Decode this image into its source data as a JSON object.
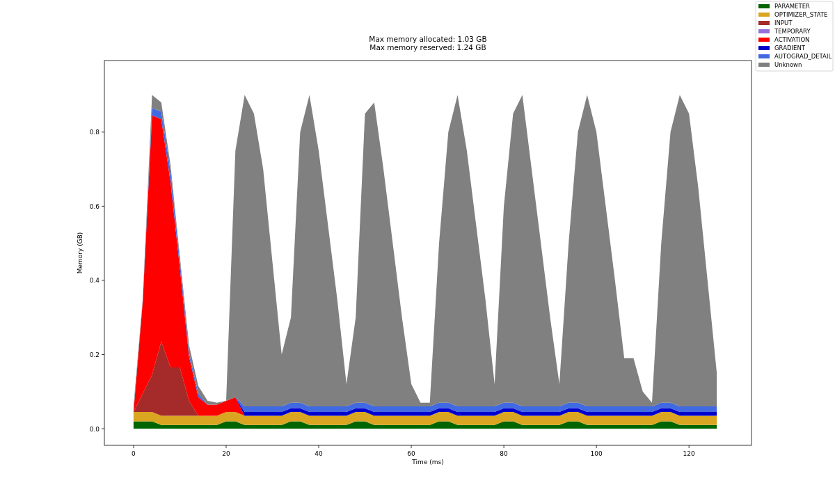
{
  "figure": {
    "chart_data": {
      "type": "area",
      "stacked": true,
      "legend": "upper right",
      "title": "Max memory allocated: 1.03 GB\nMax memory reserved: 1.24 GB",
      "xlabel": "Time (ms)",
      "ylabel": "Memory (GB)",
      "x": [
        0,
        2,
        4,
        6,
        8,
        10,
        12,
        14,
        16,
        18,
        20,
        22,
        24,
        26,
        28,
        30,
        32,
        34,
        36,
        38,
        40,
        42,
        44,
        46,
        48,
        50,
        52,
        54,
        56,
        58,
        60,
        62,
        64,
        66,
        68,
        70,
        72,
        74,
        76,
        78,
        80,
        82,
        84,
        86,
        88,
        90,
        92,
        94,
        96,
        98,
        100,
        102,
        104,
        106,
        108,
        110,
        112,
        114,
        116,
        118,
        120,
        122,
        124,
        126
      ],
      "xlim": [
        -6.3,
        133.5
      ],
      "ylim": [
        -0.045,
        0.993
      ],
      "xticks": [
        0,
        20,
        40,
        60,
        80,
        100,
        120
      ],
      "yticks": [
        {
          "value": 0,
          "label": "0.0"
        },
        {
          "value": 0.2,
          "label": "0.2"
        },
        {
          "value": 0.4,
          "label": "0.4"
        },
        {
          "value": 0.6,
          "label": "0.6"
        },
        {
          "value": 0.8,
          "label": "0.8"
        }
      ],
      "series": [
        {
          "name": "PARAMETER",
          "color": "#006400",
          "values": [
            0.02,
            0.02,
            0.02,
            0.01,
            0.01,
            0.01,
            0.01,
            0.01,
            0.01,
            0.01,
            0.02,
            0.02,
            0.01,
            0.01,
            0.01,
            0.01,
            0.01,
            0.02,
            0.02,
            0.01,
            0.01,
            0.01,
            0.01,
            0.01,
            0.02,
            0.02,
            0.01,
            0.01,
            0.01,
            0.01,
            0.01,
            0.01,
            0.01,
            0.02,
            0.02,
            0.01,
            0.01,
            0.01,
            0.01,
            0.01,
            0.02,
            0.02,
            0.01,
            0.01,
            0.01,
            0.01,
            0.01,
            0.02,
            0.02,
            0.01,
            0.01,
            0.01,
            0.01,
            0.01,
            0.01,
            0.01,
            0.01,
            0.02,
            0.02,
            0.01,
            0.01,
            0.01,
            0.01,
            0.01
          ]
        },
        {
          "name": "OPTIMIZER_STATE",
          "color": "#daa520",
          "values": [
            0.025,
            0.025,
            0.025,
            0.025,
            0.025,
            0.025,
            0.025,
            0.025,
            0.025,
            0.025,
            0.025,
            0.025,
            0.025,
            0.025,
            0.025,
            0.025,
            0.025,
            0.025,
            0.025,
            0.025,
            0.025,
            0.025,
            0.025,
            0.025,
            0.025,
            0.025,
            0.025,
            0.025,
            0.025,
            0.025,
            0.025,
            0.025,
            0.025,
            0.025,
            0.025,
            0.025,
            0.025,
            0.025,
            0.025,
            0.025,
            0.025,
            0.025,
            0.025,
            0.025,
            0.025,
            0.025,
            0.025,
            0.025,
            0.025,
            0.025,
            0.025,
            0.025,
            0.025,
            0.025,
            0.025,
            0.025,
            0.025,
            0.025,
            0.025,
            0.025,
            0.025,
            0.025,
            0.025,
            0.025
          ]
        },
        {
          "name": "INPUT",
          "color": "#a52a2a",
          "values": [
            0,
            0.05,
            0.1,
            0.2,
            0.13,
            0.13,
            0.04,
            0,
            null,
            null,
            null,
            null,
            null,
            null,
            null,
            null,
            null,
            null,
            null,
            null,
            null,
            null,
            null,
            null,
            null,
            null,
            null,
            null,
            null,
            null,
            null,
            null,
            null,
            null,
            null,
            null,
            null,
            null,
            null,
            null,
            null,
            null,
            null,
            null,
            null,
            null,
            null,
            null,
            null,
            null,
            null,
            null,
            null,
            null,
            null,
            null,
            null,
            null,
            null,
            null,
            null,
            null,
            null,
            null
          ]
        },
        {
          "name": "TEMPORARY",
          "color": "#9370db",
          "values": [
            null,
            null,
            null,
            null,
            null,
            null,
            null,
            null,
            null,
            null,
            null,
            null,
            null,
            null,
            null,
            null,
            null,
            null,
            null,
            null,
            null,
            null,
            null,
            null,
            null,
            null,
            null,
            null,
            null,
            null,
            null,
            null,
            null,
            null,
            null,
            null,
            null,
            null,
            null,
            null,
            null,
            null,
            null,
            null,
            null,
            null,
            null,
            null,
            null,
            null,
            null,
            null,
            null,
            null,
            null,
            null,
            null,
            null,
            null,
            null,
            null,
            null,
            null,
            null
          ]
        },
        {
          "name": "ACTIVATION",
          "color": "#ff0000",
          "values": [
            0,
            0.25,
            0.7,
            0.6,
            0.5,
            0.27,
            0.12,
            0.05,
            0.03,
            0.03,
            0.03,
            0.04,
            0,
            null,
            null,
            null,
            null,
            null,
            null,
            null,
            null,
            null,
            null,
            null,
            null,
            null,
            null,
            null,
            null,
            null,
            null,
            null,
            null,
            null,
            null,
            null,
            null,
            null,
            null,
            null,
            null,
            null,
            null,
            null,
            null,
            null,
            null,
            null,
            null,
            null,
            null,
            null,
            null,
            null,
            null,
            null,
            null,
            null,
            null,
            null,
            null,
            null,
            null,
            null
          ]
        },
        {
          "name": "GRADIENT",
          "color": "#0000cd",
          "values": [
            null,
            null,
            null,
            null,
            null,
            null,
            null,
            null,
            null,
            null,
            null,
            0,
            0.01,
            0.01,
            0.01,
            0.01,
            0.01,
            0.01,
            0.01,
            0.01,
            0.01,
            0.01,
            0.01,
            0.01,
            0.01,
            0.01,
            0.01,
            0.01,
            0.01,
            0.01,
            0.01,
            0.01,
            0.01,
            0.01,
            0.01,
            0.01,
            0.01,
            0.01,
            0.01,
            0.01,
            0.01,
            0.01,
            0.01,
            0.01,
            0.01,
            0.01,
            0.01,
            0.01,
            0.01,
            0.01,
            0.01,
            0.01,
            0.01,
            0.01,
            0.01,
            0.01,
            0.01,
            0.01,
            0.01,
            0.01,
            0.01,
            0.01,
            0.01,
            0.01
          ]
        },
        {
          "name": "AUTOGRAD_DETAIL",
          "color": "#4169e1",
          "values": [
            0,
            0,
            0.02,
            0.02,
            0.03,
            0.02,
            0.01,
            0.01,
            0,
            0,
            0,
            0,
            0.015,
            0.015,
            0.015,
            0.015,
            0.015,
            0.015,
            0.015,
            0.015,
            0.015,
            0.015,
            0.015,
            0.015,
            0.015,
            0.015,
            0.015,
            0.015,
            0.015,
            0.015,
            0.015,
            0.015,
            0.015,
            0.015,
            0.015,
            0.015,
            0.015,
            0.015,
            0.015,
            0.015,
            0.015,
            0.015,
            0.015,
            0.015,
            0.015,
            0.015,
            0.015,
            0.015,
            0.015,
            0.015,
            0.015,
            0.015,
            0.015,
            0.015,
            0.015,
            0.015,
            0.015,
            0.015,
            0.015,
            0.015,
            0.015,
            0.015,
            0.015,
            0.015
          ]
        },
        {
          "name": "Unknown",
          "color": "#808080",
          "values": [
            0.015,
            0.005,
            0.035,
            0.025,
            0.015,
            0.01,
            0.02,
            0.02,
            0.01,
            0.005,
            0,
            0.665,
            0.84,
            0.79,
            0.64,
            0.39,
            0.14,
            0.23,
            0.73,
            0.84,
            0.69,
            0.49,
            0.29,
            0.06,
            0.23,
            0.78,
            0.82,
            0.64,
            0.44,
            0.24,
            0.06,
            0.01,
            0.01,
            0.43,
            0.73,
            0.84,
            0.69,
            0.49,
            0.29,
            0.06,
            0.53,
            0.78,
            0.84,
            0.64,
            0.44,
            0.24,
            0.06,
            0.43,
            0.73,
            0.84,
            0.74,
            0.54,
            0.34,
            0.13,
            0.13,
            0.04,
            0.01,
            0.43,
            0.73,
            0.84,
            0.79,
            0.59,
            0.34,
            0.09
          ]
        }
      ]
    }
  }
}
